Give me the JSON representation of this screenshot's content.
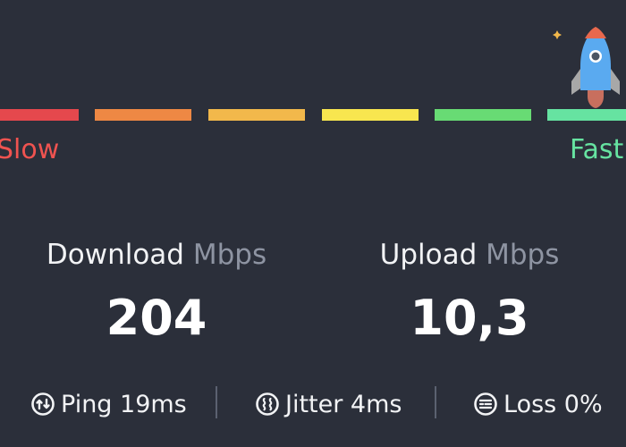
{
  "speed_scale": {
    "slow_label": "Slow",
    "fast_label": "Fast",
    "segment_colors": [
      "#e5484d",
      "#ee8844",
      "#f2b84b",
      "#f8e64f",
      "#68db74",
      "#66e3a1"
    ],
    "slow_color": "#ef5350",
    "fast_color": "#66e3a1"
  },
  "rocket_icon": "rocket-icon",
  "download": {
    "title": "Download",
    "unit": "Mbps",
    "value": "204"
  },
  "upload": {
    "title": "Upload",
    "unit": "Mbps",
    "value": "10,3"
  },
  "stats": {
    "ping": {
      "label": "Ping 19ms",
      "icon": "ping-icon"
    },
    "jitter": {
      "label": "Jitter 4ms",
      "icon": "jitter-icon"
    },
    "loss": {
      "label": "Loss 0%",
      "icon": "loss-icon"
    }
  },
  "colors": {
    "background": "#2b2f3a",
    "text": "#f2f3f5",
    "muted": "#8e94a2"
  }
}
